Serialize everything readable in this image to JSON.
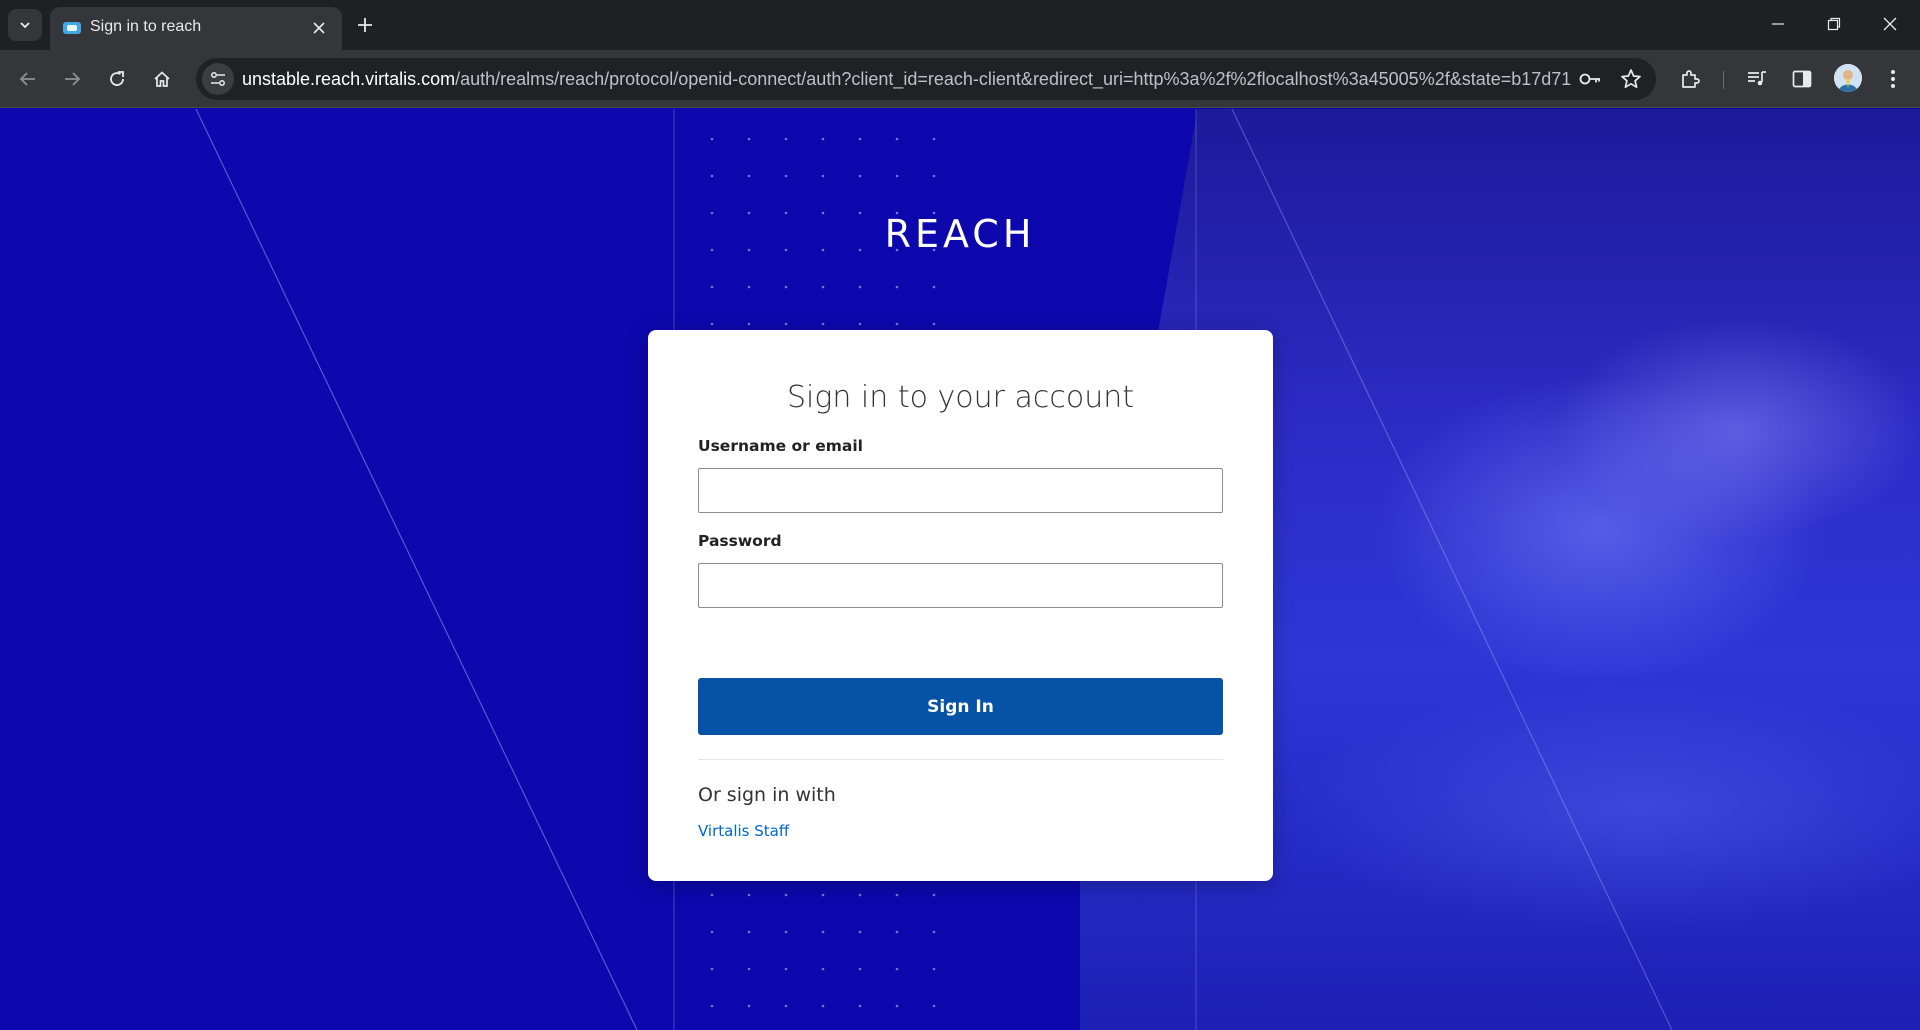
{
  "browser": {
    "tab_title": "Sign in to reach",
    "url_host": "unstable.reach.virtalis.com",
    "url_path": "/auth/realms/reach/protocol/openid-connect/auth?client_id=reach-client&redirect_uri=http%3a%2f%2flocalhost%3a45005%2f&state=b17d71e..."
  },
  "page": {
    "brand": "REACH",
    "card": {
      "title": "Sign in to your account",
      "username_label": "Username or email",
      "username_value": "",
      "password_label": "Password",
      "password_value": "",
      "sign_in_label": "Sign In",
      "or_sign_in_with": "Or sign in with",
      "provider_link": "Virtalis Staff"
    }
  },
  "colors": {
    "background": "#0c08ad",
    "button": "#0652a7",
    "link": "#0066cc"
  }
}
